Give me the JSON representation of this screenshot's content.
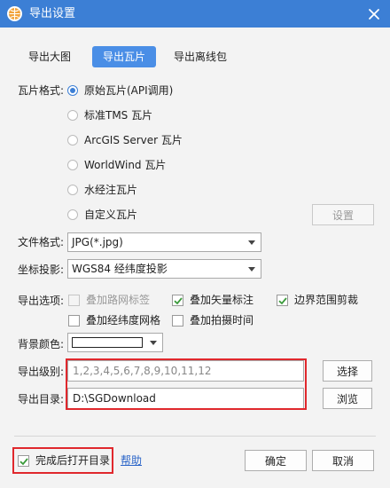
{
  "window": {
    "title": "导出设置"
  },
  "tabs": [
    {
      "label": "导出大图",
      "active": false
    },
    {
      "label": "导出瓦片",
      "active": true
    },
    {
      "label": "导出离线包",
      "active": false
    }
  ],
  "tile_format": {
    "label": "瓦片格式:",
    "options": [
      {
        "label": "原始瓦片(API调用)",
        "selected": true
      },
      {
        "label": "标准TMS 瓦片",
        "selected": false
      },
      {
        "label": "ArcGIS Server 瓦片",
        "selected": false
      },
      {
        "label": "WorldWind 瓦片",
        "selected": false
      },
      {
        "label": "水经注瓦片",
        "selected": false
      },
      {
        "label": "自定义瓦片",
        "selected": false
      }
    ],
    "settings_button": "设置"
  },
  "file_format": {
    "label": "文件格式:",
    "value": "JPG(*.jpg)"
  },
  "projection": {
    "label": "坐标投影:",
    "value": "WGS84 经纬度投影"
  },
  "export_options": {
    "label": "导出选项:",
    "items": [
      {
        "label": "叠加路网标签",
        "checked": false,
        "enabled": false
      },
      {
        "label": "叠加矢量标注",
        "checked": true,
        "enabled": true
      },
      {
        "label": "边界范围剪裁",
        "checked": true,
        "enabled": true
      },
      {
        "label": "叠加经纬度网格",
        "checked": false,
        "enabled": true
      },
      {
        "label": "叠加拍摄时间",
        "checked": false,
        "enabled": true
      }
    ]
  },
  "background_color": {
    "label": "背景颜色:",
    "value": "#ffffff"
  },
  "export_level": {
    "label": "导出级别:",
    "value": "1,2,3,4,5,6,7,8,9,10,11,12",
    "button": "选择"
  },
  "export_dir": {
    "label": "导出目录:",
    "value": "D:\\SGDownload",
    "button": "浏览"
  },
  "footer": {
    "open_after": {
      "label": "完成后打开目录",
      "checked": true
    },
    "help_link": "帮助",
    "ok_button": "确定",
    "cancel_button": "取消"
  },
  "colors": {
    "titlebar": "#3c7fd5",
    "accent": "#4a8ee6",
    "highlight_box": "#e0282d",
    "link": "#2a64c8"
  }
}
